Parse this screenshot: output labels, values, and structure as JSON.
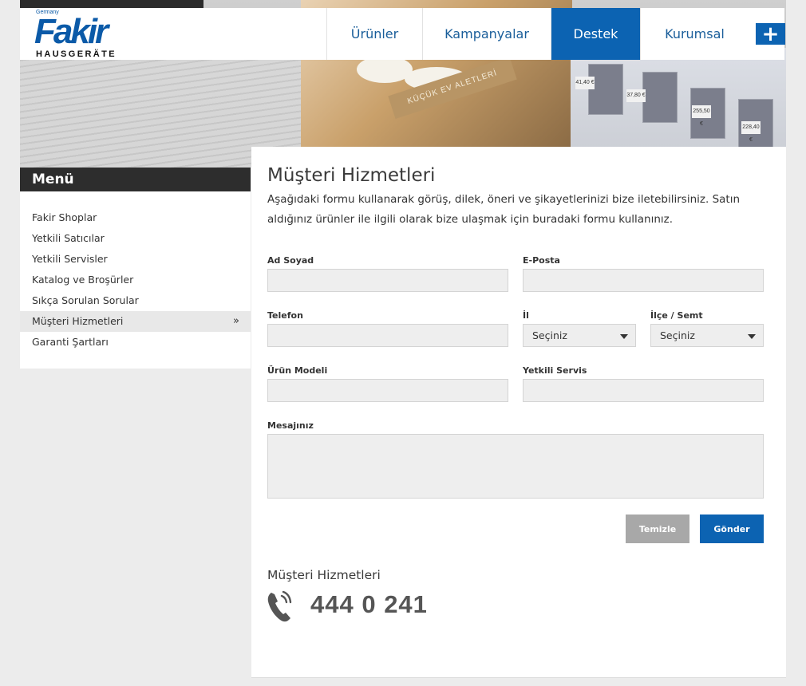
{
  "brand": {
    "top_text": "Germany",
    "name": "Fakir",
    "sub_text": "HAUSGERÄTE"
  },
  "hero": {
    "banner_text": "KÜÇÜK EV ALETLERİ",
    "price_tags": [
      "41,40 €",
      "37,80 €",
      "255,50 €",
      "228,40 €"
    ]
  },
  "nav": {
    "items": [
      {
        "label": "Ürünler",
        "active": false
      },
      {
        "label": "Kampanyalar",
        "active": false
      },
      {
        "label": "Destek",
        "active": true
      },
      {
        "label": "Kurumsal",
        "active": false
      }
    ],
    "plus_label": "+"
  },
  "sidebar": {
    "title": "Menü",
    "items": [
      {
        "label": "Fakir Shoplar",
        "active": false
      },
      {
        "label": "Yetkili Satıcılar",
        "active": false
      },
      {
        "label": "Yetkili Servisler",
        "active": false
      },
      {
        "label": "Katalog ve Broşürler",
        "active": false
      },
      {
        "label": "Sıkça Sorulan Sorular",
        "active": false
      },
      {
        "label": "Müşteri Hizmetleri",
        "active": true
      },
      {
        "label": "Garanti Şartları",
        "active": false
      }
    ],
    "active_arrow": "»"
  },
  "main": {
    "title": "Müşteri Hizmetleri",
    "intro": "Aşağıdaki formu kullanarak görüş, dilek, öneri ve şikayetlerinizi bize iletebilirsiniz. Satın aldığınız ürünler ile ilgili olarak bize ulaşmak için buradaki formu kullanınız."
  },
  "form": {
    "name_label": "Ad Soyad",
    "name_value": "",
    "email_label": "E-Posta",
    "email_value": "",
    "phone_label": "Telefon",
    "phone_value": "",
    "city_label": "İl",
    "city_selected": "Seçiniz",
    "district_label": "İlçe / Semt",
    "district_selected": "Seçiniz",
    "model_label": "Ürün Modeli",
    "model_value": "",
    "service_label": "Yetkili Servis",
    "service_value": "",
    "message_label": "Mesajınız",
    "message_value": "",
    "clear_label": "Temizle",
    "send_label": "Gönder"
  },
  "contact": {
    "title": "Müşteri Hizmetleri",
    "phone_icon": "phone-icon",
    "number": "444 0 241"
  },
  "colors": {
    "primary": "#0c63b2",
    "menu_bar": "#2d2d2d",
    "field_bg": "#eeeeee",
    "clear_button": "#a8a8a8"
  }
}
